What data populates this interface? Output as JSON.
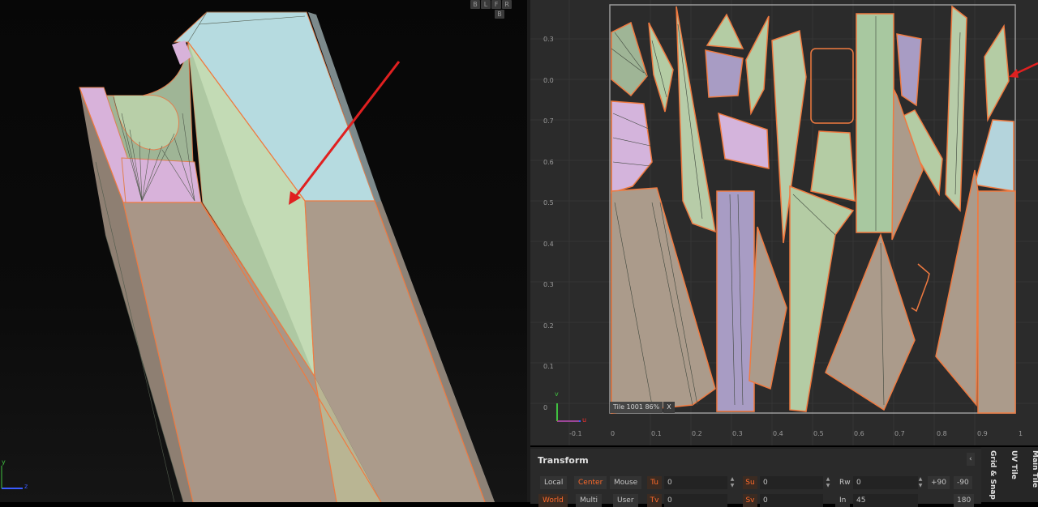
{
  "viewport3d": {
    "axis_y_label": "y",
    "axis_z_label": "z",
    "view_buttons": [
      {
        "label": "B"
      },
      {
        "label": "L"
      },
      {
        "label": "F"
      },
      {
        "label": "R"
      },
      {
        "label": "B"
      }
    ]
  },
  "uv_editor": {
    "x_ticks": [
      "-0.1",
      "0",
      "0.1",
      "0.2",
      "0.3",
      "0.4",
      "0.5",
      "0.6",
      "0.7",
      "0.8",
      "0.9",
      "1"
    ],
    "y_ticks": [
      "0.3",
      "0.0",
      "0.7",
      "0.6",
      "0.5",
      "0.4",
      "0.3",
      "0.2",
      "0.1",
      "0"
    ],
    "tile_label": "Tile 1001 86%",
    "tile_close": "X",
    "gizmo_v": "v",
    "gizmo_u": "u"
  },
  "transform": {
    "title": "Transform",
    "row1": {
      "local": "Local",
      "center": "Center",
      "mouse": "Mouse",
      "tu_axis": "Tu",
      "tu_value": "0",
      "su_axis": "Su",
      "su_value": "0",
      "rw_label": "Rw",
      "rw_value": "0",
      "plus90": "+90",
      "minus90": "-90"
    },
    "row2": {
      "world": "World",
      "multi": "Multi",
      "user": "User",
      "tv_axis": "Tv",
      "tv_value": "0",
      "sv_axis": "Sv",
      "sv_value": "0",
      "in_label": "In",
      "in_value": "45",
      "v180": "180"
    },
    "collapse": "‹"
  },
  "side_tabs": [
    {
      "label": "Grid & Snap"
    },
    {
      "label": "UV Tile"
    },
    {
      "label": "Main Tile"
    }
  ],
  "colors": {
    "accent_orange": "#ff6a2a",
    "arrow_red": "#e02020",
    "island_green": "#b4cca4",
    "island_pink": "#d4b4dc",
    "island_blue": "#b4d4dc",
    "island_tan": "#a89888",
    "island_lavender": "#a89cc4"
  }
}
